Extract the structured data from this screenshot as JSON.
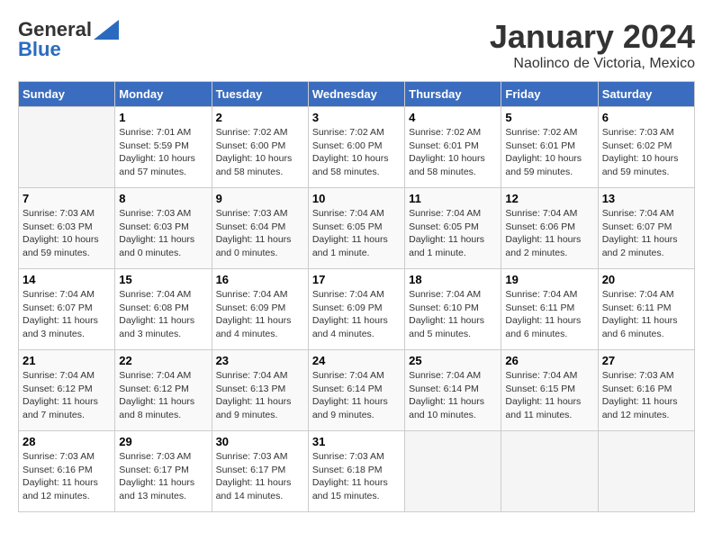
{
  "logo": {
    "general": "General",
    "blue": "Blue"
  },
  "title": "January 2024",
  "subtitle": "Naolinco de Victoria, Mexico",
  "days_of_week": [
    "Sunday",
    "Monday",
    "Tuesday",
    "Wednesday",
    "Thursday",
    "Friday",
    "Saturday"
  ],
  "weeks": [
    [
      {
        "day": "",
        "sunrise": "",
        "sunset": "",
        "daylight": "",
        "empty": true
      },
      {
        "day": "1",
        "sunrise": "Sunrise: 7:01 AM",
        "sunset": "Sunset: 5:59 PM",
        "daylight": "Daylight: 10 hours and 57 minutes."
      },
      {
        "day": "2",
        "sunrise": "Sunrise: 7:02 AM",
        "sunset": "Sunset: 6:00 PM",
        "daylight": "Daylight: 10 hours and 58 minutes."
      },
      {
        "day": "3",
        "sunrise": "Sunrise: 7:02 AM",
        "sunset": "Sunset: 6:00 PM",
        "daylight": "Daylight: 10 hours and 58 minutes."
      },
      {
        "day": "4",
        "sunrise": "Sunrise: 7:02 AM",
        "sunset": "Sunset: 6:01 PM",
        "daylight": "Daylight: 10 hours and 58 minutes."
      },
      {
        "day": "5",
        "sunrise": "Sunrise: 7:02 AM",
        "sunset": "Sunset: 6:01 PM",
        "daylight": "Daylight: 10 hours and 59 minutes."
      },
      {
        "day": "6",
        "sunrise": "Sunrise: 7:03 AM",
        "sunset": "Sunset: 6:02 PM",
        "daylight": "Daylight: 10 hours and 59 minutes."
      }
    ],
    [
      {
        "day": "7",
        "sunrise": "Sunrise: 7:03 AM",
        "sunset": "Sunset: 6:03 PM",
        "daylight": "Daylight: 10 hours and 59 minutes."
      },
      {
        "day": "8",
        "sunrise": "Sunrise: 7:03 AM",
        "sunset": "Sunset: 6:03 PM",
        "daylight": "Daylight: 11 hours and 0 minutes."
      },
      {
        "day": "9",
        "sunrise": "Sunrise: 7:03 AM",
        "sunset": "Sunset: 6:04 PM",
        "daylight": "Daylight: 11 hours and 0 minutes."
      },
      {
        "day": "10",
        "sunrise": "Sunrise: 7:04 AM",
        "sunset": "Sunset: 6:05 PM",
        "daylight": "Daylight: 11 hours and 1 minute."
      },
      {
        "day": "11",
        "sunrise": "Sunrise: 7:04 AM",
        "sunset": "Sunset: 6:05 PM",
        "daylight": "Daylight: 11 hours and 1 minute."
      },
      {
        "day": "12",
        "sunrise": "Sunrise: 7:04 AM",
        "sunset": "Sunset: 6:06 PM",
        "daylight": "Daylight: 11 hours and 2 minutes."
      },
      {
        "day": "13",
        "sunrise": "Sunrise: 7:04 AM",
        "sunset": "Sunset: 6:07 PM",
        "daylight": "Daylight: 11 hours and 2 minutes."
      }
    ],
    [
      {
        "day": "14",
        "sunrise": "Sunrise: 7:04 AM",
        "sunset": "Sunset: 6:07 PM",
        "daylight": "Daylight: 11 hours and 3 minutes."
      },
      {
        "day": "15",
        "sunrise": "Sunrise: 7:04 AM",
        "sunset": "Sunset: 6:08 PM",
        "daylight": "Daylight: 11 hours and 3 minutes."
      },
      {
        "day": "16",
        "sunrise": "Sunrise: 7:04 AM",
        "sunset": "Sunset: 6:09 PM",
        "daylight": "Daylight: 11 hours and 4 minutes."
      },
      {
        "day": "17",
        "sunrise": "Sunrise: 7:04 AM",
        "sunset": "Sunset: 6:09 PM",
        "daylight": "Daylight: 11 hours and 4 minutes."
      },
      {
        "day": "18",
        "sunrise": "Sunrise: 7:04 AM",
        "sunset": "Sunset: 6:10 PM",
        "daylight": "Daylight: 11 hours and 5 minutes."
      },
      {
        "day": "19",
        "sunrise": "Sunrise: 7:04 AM",
        "sunset": "Sunset: 6:11 PM",
        "daylight": "Daylight: 11 hours and 6 minutes."
      },
      {
        "day": "20",
        "sunrise": "Sunrise: 7:04 AM",
        "sunset": "Sunset: 6:11 PM",
        "daylight": "Daylight: 11 hours and 6 minutes."
      }
    ],
    [
      {
        "day": "21",
        "sunrise": "Sunrise: 7:04 AM",
        "sunset": "Sunset: 6:12 PM",
        "daylight": "Daylight: 11 hours and 7 minutes."
      },
      {
        "day": "22",
        "sunrise": "Sunrise: 7:04 AM",
        "sunset": "Sunset: 6:12 PM",
        "daylight": "Daylight: 11 hours and 8 minutes."
      },
      {
        "day": "23",
        "sunrise": "Sunrise: 7:04 AM",
        "sunset": "Sunset: 6:13 PM",
        "daylight": "Daylight: 11 hours and 9 minutes."
      },
      {
        "day": "24",
        "sunrise": "Sunrise: 7:04 AM",
        "sunset": "Sunset: 6:14 PM",
        "daylight": "Daylight: 11 hours and 9 minutes."
      },
      {
        "day": "25",
        "sunrise": "Sunrise: 7:04 AM",
        "sunset": "Sunset: 6:14 PM",
        "daylight": "Daylight: 11 hours and 10 minutes."
      },
      {
        "day": "26",
        "sunrise": "Sunrise: 7:04 AM",
        "sunset": "Sunset: 6:15 PM",
        "daylight": "Daylight: 11 hours and 11 minutes."
      },
      {
        "day": "27",
        "sunrise": "Sunrise: 7:03 AM",
        "sunset": "Sunset: 6:16 PM",
        "daylight": "Daylight: 11 hours and 12 minutes."
      }
    ],
    [
      {
        "day": "28",
        "sunrise": "Sunrise: 7:03 AM",
        "sunset": "Sunset: 6:16 PM",
        "daylight": "Daylight: 11 hours and 12 minutes."
      },
      {
        "day": "29",
        "sunrise": "Sunrise: 7:03 AM",
        "sunset": "Sunset: 6:17 PM",
        "daylight": "Daylight: 11 hours and 13 minutes."
      },
      {
        "day": "30",
        "sunrise": "Sunrise: 7:03 AM",
        "sunset": "Sunset: 6:17 PM",
        "daylight": "Daylight: 11 hours and 14 minutes."
      },
      {
        "day": "31",
        "sunrise": "Sunrise: 7:03 AM",
        "sunset": "Sunset: 6:18 PM",
        "daylight": "Daylight: 11 hours and 15 minutes."
      },
      {
        "day": "",
        "sunrise": "",
        "sunset": "",
        "daylight": "",
        "empty": true
      },
      {
        "day": "",
        "sunrise": "",
        "sunset": "",
        "daylight": "",
        "empty": true
      },
      {
        "day": "",
        "sunrise": "",
        "sunset": "",
        "daylight": "",
        "empty": true
      }
    ]
  ]
}
